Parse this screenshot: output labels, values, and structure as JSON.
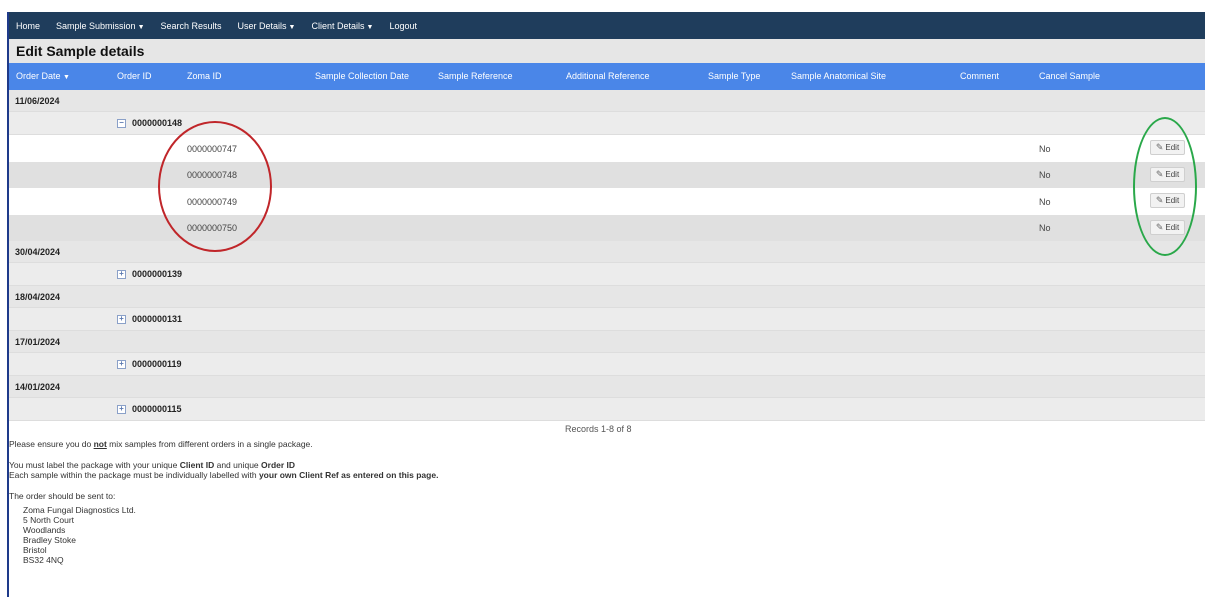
{
  "nav": {
    "home": "Home",
    "sample_submission": "Sample Submission",
    "search_results": "Search Results",
    "user_details": "User Details",
    "client_details": "Client Details",
    "logout": "Logout"
  },
  "page_title": "Edit Sample details",
  "columns": {
    "order_date": "Order Date",
    "order_id": "Order ID",
    "zoma_id": "Zoma ID",
    "collection_date": "Sample Collection Date",
    "sample_reference": "Sample Reference",
    "additional_reference": "Additional Reference",
    "sample_type": "Sample Type",
    "anatomical_site": "Sample Anatomical Site",
    "comment": "Comment",
    "cancel_sample": "Cancel Sample"
  },
  "groups": [
    {
      "date": "11/06/2024",
      "order": "0000000148",
      "expanded_symbol": "−",
      "samples": [
        {
          "zoma_id": "0000000747",
          "cancel": "No",
          "edit": "Edit"
        },
        {
          "zoma_id": "0000000748",
          "cancel": "No",
          "edit": "Edit"
        },
        {
          "zoma_id": "0000000749",
          "cancel": "No",
          "edit": "Edit"
        },
        {
          "zoma_id": "0000000750",
          "cancel": "No",
          "edit": "Edit"
        }
      ]
    },
    {
      "date": "30/04/2024",
      "order": "0000000139",
      "expanded_symbol": "+"
    },
    {
      "date": "18/04/2024",
      "order": "0000000131",
      "expanded_symbol": "+"
    },
    {
      "date": "17/01/2024",
      "order": "0000000119",
      "expanded_symbol": "+"
    },
    {
      "date": "14/01/2024",
      "order": "0000000115",
      "expanded_symbol": "+"
    }
  ],
  "records": "Records 1-8 of 8",
  "notes": {
    "line1_a": "Please ensure you do ",
    "line1_b": "not",
    "line1_c": " mix samples from different orders in a single package.",
    "line2_a": "You must label the package with your unique ",
    "line2_b": "Client ID",
    "line2_c": " and unique ",
    "line2_d": "Order ID",
    "line3_a": "Each sample within the package must be individually labelled with ",
    "line3_b": "your own Client Ref as entered on this page.",
    "line4": "The order should be sent to:",
    "address": [
      "Zoma Fungal Diagnostics Ltd.",
      "5 North Court",
      "Woodlands",
      "Bradley Stoke",
      "Bristol",
      "BS32 4NQ"
    ]
  },
  "colors": {
    "navbar": "#1f3d5c",
    "header": "#4a86e8",
    "annotation_red": "#c0262a",
    "annotation_green": "#2aa84a"
  }
}
